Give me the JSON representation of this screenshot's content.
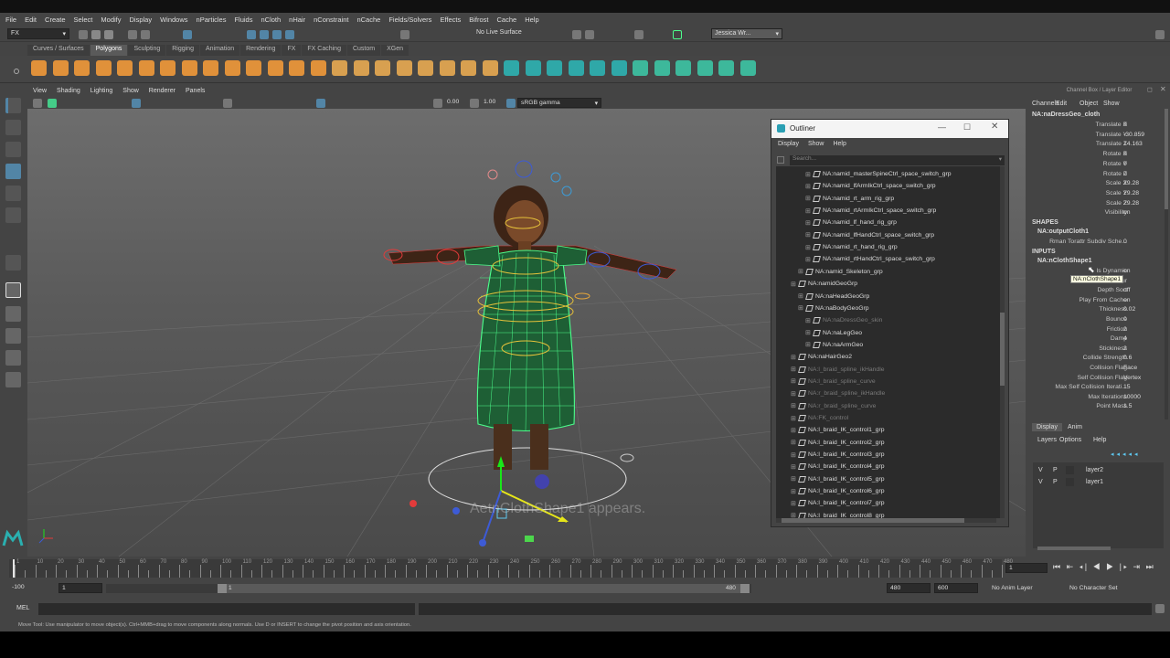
{
  "menus": [
    "File",
    "Edit",
    "Create",
    "Select",
    "Modify",
    "Display",
    "Windows",
    "nParticles",
    "Fluids",
    "nCloth",
    "nHair",
    "nConstraint",
    "nCache",
    "Fields/Solvers",
    "Effects",
    "Bifrost",
    "Cache",
    "Help"
  ],
  "status_line": {
    "menuset": "FX",
    "live_surface": "No Live Surface",
    "user": "Jessica Wr..."
  },
  "shelf_tabs": [
    "Curves / Surfaces",
    "Polygons",
    "Sculpting",
    "Rigging",
    "Animation",
    "Rendering",
    "FX",
    "FX Caching",
    "Custom",
    "XGen"
  ],
  "active_shelf_tab": "Polygons",
  "panel_menu": [
    "View",
    "Shading",
    "Lighting",
    "Show",
    "Renderer",
    "Panels"
  ],
  "panel_toolbar": {
    "exposure": "0.00",
    "gamma": "1.00",
    "color_space": "sRGB gamma"
  },
  "viewport_caption": "AetnClothShape1 appears.",
  "outliner": {
    "title": "Outliner",
    "menus": [
      "Display",
      "Show",
      "Help"
    ],
    "search_placeholder": "Search...",
    "rows": [
      {
        "label": "NA:namid_masterSpineCtrl_space_switch_grp",
        "indent": 3,
        "dim": false
      },
      {
        "label": "NA:namid_lfArmIkCtrl_space_switch_grp",
        "indent": 3,
        "dim": false
      },
      {
        "label": "NA:namid_rt_arm_rig_grp",
        "indent": 3,
        "dim": false
      },
      {
        "label": "NA:namid_rtArmIkCtrl_space_switch_grp",
        "indent": 3,
        "dim": false
      },
      {
        "label": "NA:namid_lf_hand_rig_grp",
        "indent": 3,
        "dim": false
      },
      {
        "label": "NA:namid_lfHandCtrl_space_switch_grp",
        "indent": 3,
        "dim": false
      },
      {
        "label": "NA:namid_rt_hand_rig_grp",
        "indent": 3,
        "dim": false
      },
      {
        "label": "NA:namid_rtHandCtrl_space_switch_grp",
        "indent": 3,
        "dim": false
      },
      {
        "label": "NA:namid_Skeleton_grp",
        "indent": 2,
        "dim": false
      },
      {
        "label": "NA:namidGeoGrp",
        "indent": 1,
        "dim": false
      },
      {
        "label": "NA:naHeadGeoGrp",
        "indent": 2,
        "dim": false
      },
      {
        "label": "NA:naBodyGeoGrp",
        "indent": 2,
        "dim": false
      },
      {
        "label": "NA:naDressGeo_skin",
        "indent": 3,
        "dim": true
      },
      {
        "label": "NA:naLegGeo",
        "indent": 3,
        "dim": false
      },
      {
        "label": "NA:naArmGeo",
        "indent": 3,
        "dim": false
      },
      {
        "label": "NA:naHairGeo2",
        "indent": 1,
        "dim": false
      },
      {
        "label": "NA:l_braid_spline_ikHandle",
        "indent": 1,
        "dim": true
      },
      {
        "label": "NA:l_braid_spline_curve",
        "indent": 1,
        "dim": true
      },
      {
        "label": "NA:r_braid_spline_ikHandle",
        "indent": 1,
        "dim": true
      },
      {
        "label": "NA:r_braid_spline_curve",
        "indent": 1,
        "dim": true
      },
      {
        "label": "NA:FK_control",
        "indent": 1,
        "dim": true
      },
      {
        "label": "NA:l_braid_IK_control1_grp",
        "indent": 1,
        "dim": false
      },
      {
        "label": "NA:l_braid_IK_control2_grp",
        "indent": 1,
        "dim": false
      },
      {
        "label": "NA:l_braid_IK_control3_grp",
        "indent": 1,
        "dim": false
      },
      {
        "label": "NA:l_braid_IK_control4_grp",
        "indent": 1,
        "dim": false
      },
      {
        "label": "NA:l_braid_IK_control5_grp",
        "indent": 1,
        "dim": false
      },
      {
        "label": "NA:l_braid_IK_control6_grp",
        "indent": 1,
        "dim": false
      },
      {
        "label": "NA:l_braid_IK_control7_grp",
        "indent": 1,
        "dim": false
      },
      {
        "label": "NA:l_braid_IK_control8_grp",
        "indent": 1,
        "dim": false
      }
    ]
  },
  "channel_box": {
    "header": "Channel Box / Layer Editor",
    "menus": [
      "Channels",
      "Edit",
      "Object",
      "Show"
    ],
    "object_name": "NA:naDressGeo_cloth",
    "transform": [
      {
        "label": "Translate X",
        "value": "0"
      },
      {
        "label": "Translate Y",
        "value": "-30.859"
      },
      {
        "label": "Translate Z",
        "value": "14.163"
      },
      {
        "label": "Rotate X",
        "value": "0"
      },
      {
        "label": "Rotate Y",
        "value": "0"
      },
      {
        "label": "Rotate Z",
        "value": "0"
      },
      {
        "label": "Scale X",
        "value": "29.28"
      },
      {
        "label": "Scale Y",
        "value": "29.28"
      },
      {
        "label": "Scale Z",
        "value": "29.28"
      },
      {
        "label": "Visibility",
        "value": "on"
      }
    ],
    "shapes_title": "SHAPES",
    "shape_name": "NA:outputCloth1",
    "shape_attrs": [
      {
        "label": "Rman Torattr Subdiv Sche...",
        "value": "0"
      }
    ],
    "inputs_title": "INPUTS",
    "input_name": "NA:nClothShape1",
    "tooltip": "NA:nClothShape1",
    "input_attrs": [
      {
        "label": "Is Dynamic",
        "value": "on"
      },
      {
        "label": "Cur",
        "value": ""
      },
      {
        "label": "Depth Sort",
        "value": "off"
      },
      {
        "label": "Play From Cache",
        "value": "on"
      },
      {
        "label": "Thickness",
        "value": "0.02"
      },
      {
        "label": "Bounce",
        "value": "0"
      },
      {
        "label": "Friction",
        "value": "2"
      },
      {
        "label": "Damp",
        "value": "4"
      },
      {
        "label": "Stickiness",
        "value": "2"
      },
      {
        "label": "Collide Strength",
        "value": "0.6"
      },
      {
        "label": "Collision Flag",
        "value": "Face"
      },
      {
        "label": "Self Collision Flag",
        "value": "Vertex"
      },
      {
        "label": "Max Self Collision Iterati...",
        "value": "15"
      },
      {
        "label": "Max Iterations",
        "value": "10000"
      },
      {
        "label": "Point Mass",
        "value": "1.5"
      }
    ],
    "tabs": [
      "Display",
      "Anim"
    ],
    "layer_menus": [
      "Layers",
      "Options",
      "Help"
    ],
    "layers": [
      {
        "v": "V",
        "p": "P",
        "name": "layer2"
      },
      {
        "v": "V",
        "p": "P",
        "name": "layer1"
      }
    ]
  },
  "timeline": {
    "ticks": [
      "1",
      "5",
      "10",
      "15",
      "20",
      "25",
      "30",
      "35",
      "40",
      "45",
      "50",
      "55",
      "60",
      "65",
      "70",
      "75",
      "80",
      "85",
      "90",
      "95",
      "100",
      "105",
      "110",
      "115",
      "120",
      "125",
      "130",
      "135",
      "140",
      "145",
      "150",
      "155",
      "160",
      "165",
      "170",
      "175",
      "180",
      "185",
      "190",
      "195",
      "200",
      "205",
      "210",
      "215",
      "220",
      "225",
      "230",
      "235",
      "240",
      "245",
      "250",
      "255",
      "260",
      "265",
      "270",
      "275",
      "280",
      "285",
      "290",
      "295",
      "300",
      "305",
      "310",
      "315",
      "320",
      "325",
      "330",
      "335",
      "340",
      "345",
      "350",
      "355",
      "360",
      "365",
      "370",
      "375",
      "380",
      "385",
      "390",
      "395",
      "400",
      "405",
      "410",
      "415",
      "420",
      "425",
      "430",
      "435",
      "440",
      "445",
      "450",
      "455",
      "460",
      "465",
      "470",
      "475",
      "480"
    ],
    "current_frame": "1"
  },
  "range": {
    "anim_start": "-100",
    "start": "1",
    "slider_start": "1",
    "slider_end": "480",
    "end": "480",
    "anim_end": "600",
    "anim_layer": "No Anim Layer",
    "char_set": "No Character Set"
  },
  "command_line": {
    "label": "MEL"
  },
  "help_line": "Move Tool: Use manipulator to move object(s). Ctrl+MMB+drag to move components along normals. Use D or INSERT to change the pivot position and axis orientation.",
  "colors": {
    "accent": "#5285a6",
    "mesh": "#4cff8c",
    "handle_red": "#e33b3b"
  }
}
